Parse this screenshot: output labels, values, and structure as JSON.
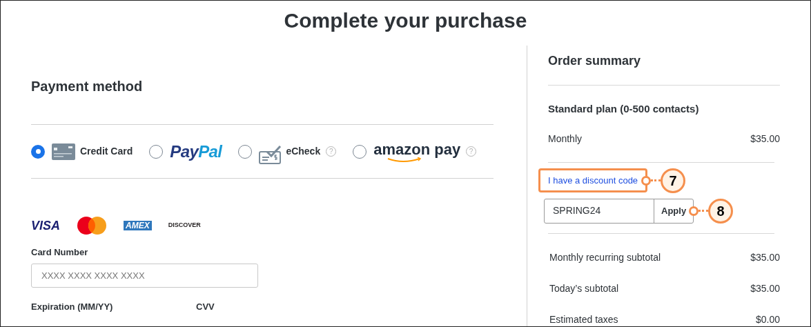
{
  "title": "Complete your purchase",
  "payment": {
    "heading": "Payment method",
    "methods": [
      {
        "kind": "card",
        "label": "Credit Card",
        "selected": true
      },
      {
        "kind": "paypal",
        "parts": [
          "Pay",
          "Pal"
        ],
        "selected": false
      },
      {
        "kind": "echeck",
        "label": "eCheck",
        "help": "?",
        "selected": false
      },
      {
        "kind": "amazon",
        "label": "amazon pay",
        "help": "?",
        "selected": false
      }
    ],
    "brands": [
      {
        "kind": "visa",
        "label": "VISA"
      },
      {
        "kind": "mastercard"
      },
      {
        "kind": "amex",
        "label": "AMEX"
      },
      {
        "kind": "discover",
        "label": "DISCOVER"
      }
    ],
    "card_number": {
      "label": "Card Number",
      "placeholder": "XXXX XXXX XXXX XXXX"
    },
    "expiration": {
      "label": "Expiration (MM/YY)"
    },
    "cvv": {
      "label": "CVV"
    }
  },
  "summary": {
    "heading": "Order summary",
    "plan": "Standard plan (0-500 contacts)",
    "plan_lines": [
      {
        "label": "Monthly",
        "amount": "$35.00"
      }
    ],
    "discount_link": "I have a discount code",
    "discount_code": "SPRING24",
    "apply": "Apply",
    "totals": [
      {
        "label": "Monthly recurring subtotal",
        "amount": "$35.00"
      },
      {
        "label": "Today’s subtotal",
        "amount": "$35.00"
      },
      {
        "label": "Estimated taxes",
        "amount": "$0.00"
      }
    ]
  },
  "annotations": [
    {
      "number": "7"
    },
    {
      "number": "8"
    }
  ]
}
